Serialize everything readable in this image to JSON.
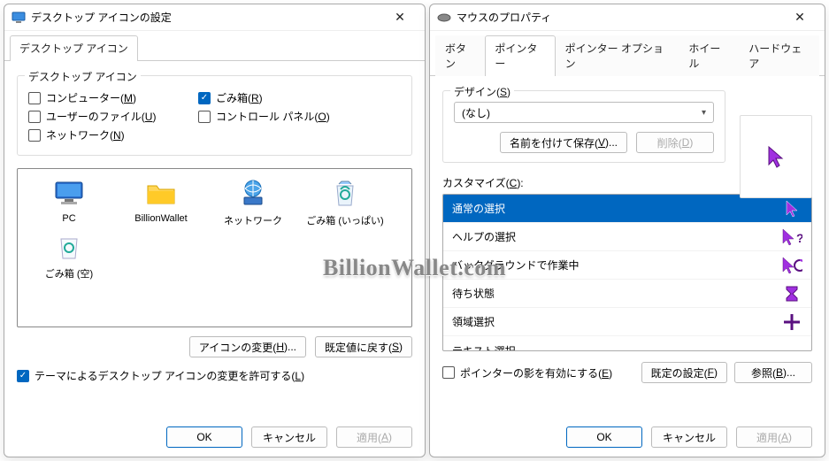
{
  "left": {
    "title": "デスクトップ アイコンの設定",
    "tab": "デスクトップ アイコン",
    "group_legend": "デスクトップ アイコン",
    "checks": {
      "computer": "コンピューター(M)",
      "recycle": "ごみ箱(R)",
      "userfiles": "ユーザーのファイル(U)",
      "ctrlpanel": "コントロール パネル(O)",
      "network": "ネットワーク(N)"
    },
    "icons": {
      "pc": "PC",
      "folder": "BillionWallet",
      "network": "ネットワーク",
      "bin_full": "ごみ箱 (いっぱい)",
      "bin_empty": "ごみ箱 (空)"
    },
    "change_icon": "アイコンの変更(H)...",
    "reset_default": "既定値に戻す(S)",
    "allow_theme": "テーマによるデスクトップ アイコンの変更を許可する(L)",
    "ok": "OK",
    "cancel": "キャンセル",
    "apply": "適用(A)"
  },
  "right": {
    "title": "マウスのプロパティ",
    "tabs": {
      "buttons": "ボタン",
      "pointers": "ポインター",
      "options": "ポインター オプション",
      "wheel": "ホイール",
      "hardware": "ハードウェア"
    },
    "design_legend": "デザイン(S)",
    "design_value": "(なし)",
    "save_as": "名前を付けて保存(V)...",
    "delete": "削除(D)",
    "customize_label": "カスタマイズ(C):",
    "cust": {
      "normal": "通常の選択",
      "help": "ヘルプの選択",
      "background": "バックグラウンドで作業中",
      "busy": "待ち状態",
      "precision": "領域選択",
      "text": "テキスト選択"
    },
    "shadow": "ポインターの影を有効にする(E)",
    "default_btn": "既定の設定(F)",
    "browse": "参照(B)...",
    "ok": "OK",
    "cancel": "キャンセル",
    "apply": "適用(A)"
  },
  "watermark": "BillionWallet.com"
}
